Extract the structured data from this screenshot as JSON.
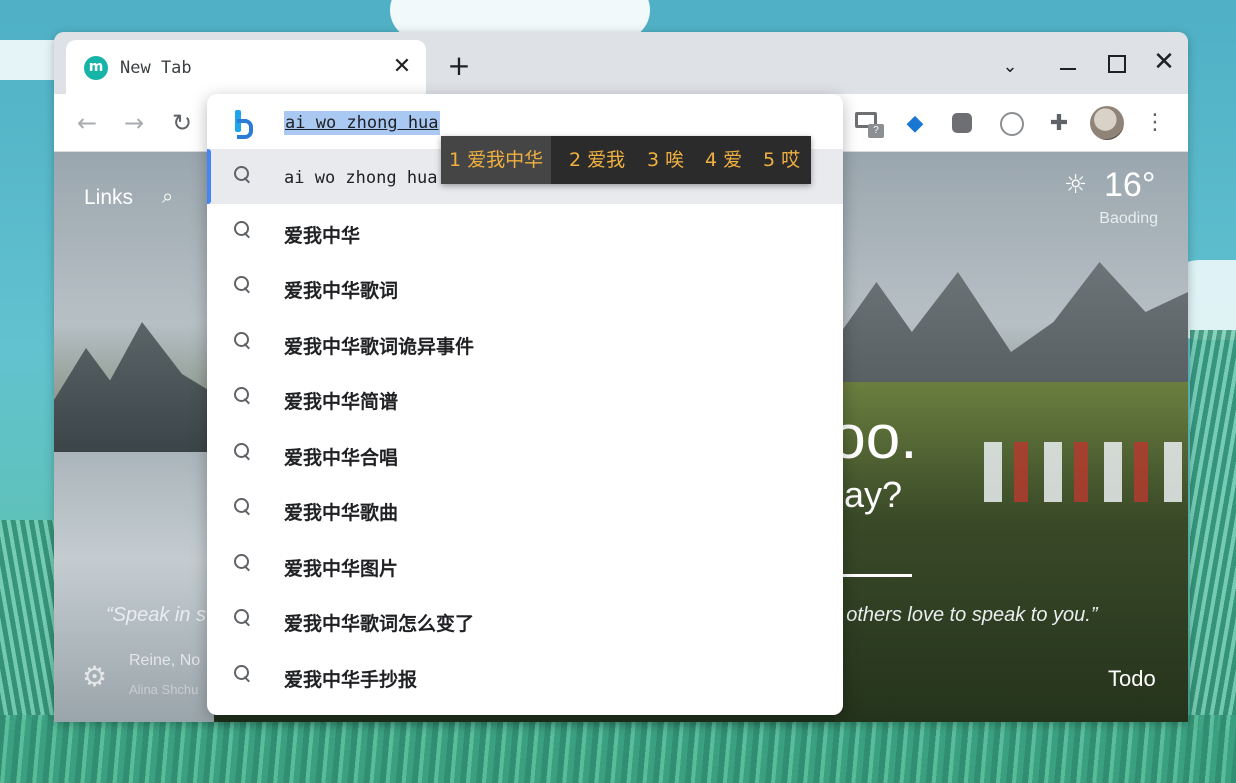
{
  "browser": {
    "tab": {
      "favicon": "m",
      "title": "New Tab",
      "close_icon": "✕"
    },
    "new_tab_icon": "+",
    "window_controls": {
      "tab_search_icon": "⌄",
      "minimize_icon": "",
      "maximize_icon": "",
      "close_icon": "✕"
    },
    "toolbar": {
      "back_icon": "←",
      "forward_icon": "→",
      "reload_icon": "↻",
      "extensions": [
        "gmail-checker-icon",
        "gem-icon",
        "tampermonkey-icon",
        "circle-extension-icon",
        "extensions-puzzle-icon"
      ],
      "gmail_badge": "?",
      "menu_icon": "⋮"
    }
  },
  "omnibox": {
    "engine_icon": "bing-icon",
    "input_text": "ai wo zhong hua",
    "suggestions": [
      {
        "text": "ai wo zhong hua",
        "selected": true
      },
      {
        "text": "爱我中华"
      },
      {
        "text": "爱我中华歌词"
      },
      {
        "text": "爱我中华歌词诡异事件"
      },
      {
        "text": "爱我中华简谱"
      },
      {
        "text": "爱我中华合唱"
      },
      {
        "text": "爱我中华歌曲"
      },
      {
        "text": "爱我中华图片"
      },
      {
        "text": "爱我中华歌词怎么变了"
      },
      {
        "text": "爱我中华手抄报"
      }
    ]
  },
  "ime": {
    "candidates": [
      "1 爱我中华",
      "2 爱我",
      "3 唉",
      "4 爱",
      "5 哎"
    ]
  },
  "newtab": {
    "links_label": "Links",
    "weather": {
      "temp": "16°",
      "location": "Baoding",
      "icon": "☼"
    },
    "greeting_fragment": "too.",
    "focus_fragment": "day?",
    "quote_left": "“Speak in s",
    "quote_right": "at others love to speak to you.”",
    "photo_location": "Reine, No",
    "photo_author": "Alina Shchu",
    "todo_label": "Todo",
    "settings_icon": "⚙"
  }
}
